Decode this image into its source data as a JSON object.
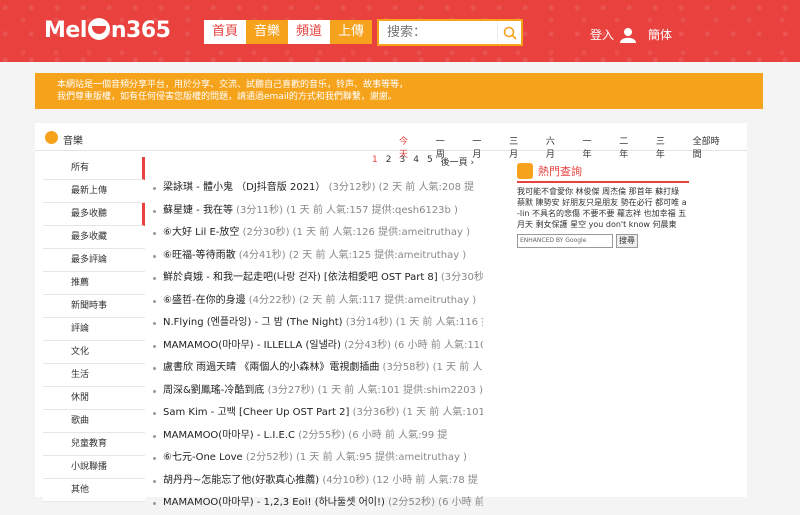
{
  "logo": {
    "text_left": "Mel",
    "text_right": "n365"
  },
  "nav": [
    {
      "label": "首頁"
    },
    {
      "label": "音樂"
    },
    {
      "label": "頻道"
    },
    {
      "label": "上傳"
    }
  ],
  "search": {
    "placeholder": "搜索："
  },
  "header_right": {
    "login": "登入",
    "lang": "簡体"
  },
  "notice": {
    "line1": "本網站是一個音頻分享平台，用於分享、交流、試聽自己喜歡的音乐，铃声、故事等等，",
    "line2": "我們尊重版權，如有任何侵害您版權的問題，請通過email的方式和我們聯繫，謝謝。"
  },
  "panel": {
    "title": "音樂"
  },
  "time_tabs": [
    "今天",
    "一周",
    "一月",
    "三月",
    "六月",
    "一年",
    "二年",
    "三年",
    "全部時間"
  ],
  "sidebar": [
    "所有",
    "最新上傳",
    "最多收聽",
    "最多收藏",
    "最多評論",
    "推薦",
    "新聞時事",
    "評論",
    "文化",
    "生活",
    "休閒",
    "歌曲",
    "兒童教育",
    "小說聯播",
    "其他"
  ],
  "pager": [
    "1",
    "2",
    "3",
    "4",
    "5",
    "後一頁 ›"
  ],
  "songs": [
    {
      "title": "梁詠琪 - 體小鬼 （DJ抖音版 2021）",
      "meta": "(3分12秒) (2 天 前 人氣:208 提"
    },
    {
      "title": "蘇星婕 - 我在等",
      "meta": "(3分11秒) (1 天 前 人氣:157 提供:qesh6123b )"
    },
    {
      "title": "⑥大好 Lil E-放空",
      "meta": "(2分30秒) (1 天 前 人氣:126 提供:ameitruthay )"
    },
    {
      "title": "⑥旺福-等待雨散",
      "meta": "(4分41秒) (2 天 前 人氣:125 提供:ameitruthay )"
    },
    {
      "title": "鮮於貞娥 - 和我一起走吧(나랑 걷자) [依法相愛吧 OST Part 8]",
      "meta": "(3分30秒)"
    },
    {
      "title": "⑥盛哲-在你的身邊",
      "meta": "(4分22秒) (2 天 前 人氣:117 提供:ameitruthay )"
    },
    {
      "title": "N.Flying (엔플라잉) - 그 밤 (The Night)",
      "meta": "(3分14秒) (1 天 前 人氣:116 提"
    },
    {
      "title": "MAMAMOO(마마무) - ILLELLA (일낼라)",
      "meta": "(2分43秒) (6 小時 前 人氣:110"
    },
    {
      "title": "盧書欣 雨過天晴 《兩個人的小森林》電視劇插曲",
      "meta": "(3分58秒) (1 天 前 人"
    },
    {
      "title": "周深&劉鳳瑤-冷酷到底",
      "meta": "(3分27秒) (1 天 前 人氣:101 提供:shim2203 )"
    },
    {
      "title": "Sam Kim - 고백 [Cheer Up OST Part 2]",
      "meta": "(3分36秒) (1 天 前 人氣:101 提"
    },
    {
      "title": "MAMAMOO(마마무) - L.I.E.C",
      "meta": "(2分55秒) (6 小時 前 人氣:99 提"
    },
    {
      "title": "⑥七元-One Love",
      "meta": "(2分52秒) (1 天 前 人氣:95 提供:ameitruthay )"
    },
    {
      "title": "胡丹丹~怎能忘了他(好歌真心推薦)",
      "meta": "(4分10秒) (12 小時 前 人氣:78 提"
    },
    {
      "title": "MAMAMOO(마마무) - 1,2,3 Eoi! (하나둘셋 어이!)",
      "meta": "(2分52秒) (6 小時 前"
    }
  ],
  "hot": {
    "title": "熱門查詢",
    "keywords": "我可能不會愛你 林俊傑 周杰倫 那首年 蘇打綠 蔡默 陳勢安 好朋友只是朋友 勢在必行 都可唯 a-lin 不具名的悲傷 不要不要 蘿志祥 也加幸福 五月天 剩女保護 星空 you don't know 何晨東",
    "google_label": "ENHANCED BY Google",
    "search_btn": "搜尋"
  }
}
